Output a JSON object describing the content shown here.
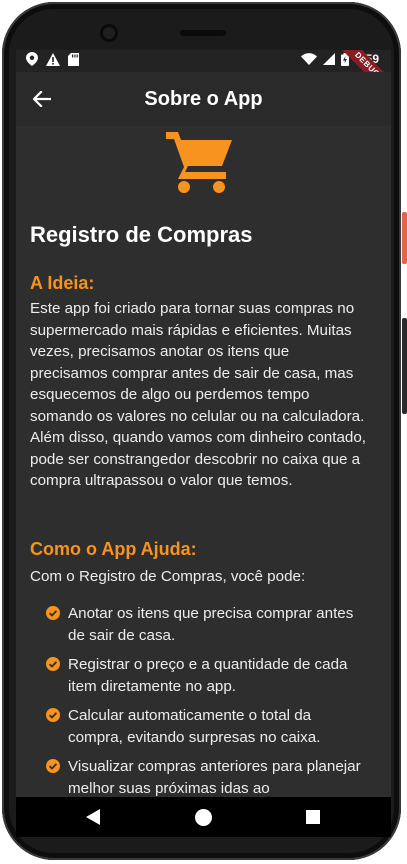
{
  "status_bar": {
    "time": "9:59",
    "debug_label": "DEBUG"
  },
  "app_bar": {
    "title": "Sobre o App"
  },
  "content": {
    "main_title": "Registro de Compras",
    "idea_title": "A Ideia:",
    "idea_text": "Este app foi criado para tornar suas compras no supermercado mais rápidas e eficientes. Muitas vezes, precisamos anotar os itens que precisamos comprar antes de sair de casa, mas esquecemos de algo ou perdemos tempo somando os valores no celular ou na calculadora. Além disso, quando vamos com dinheiro contado, pode ser constrangedor descobrir no caixa que a compra ultrapassou o valor que temos.",
    "help_title": "Como o App Ajuda:",
    "help_intro": "Com o Registro de Compras, você pode:",
    "bullets": [
      "Anotar os itens que precisa comprar antes de sair de casa.",
      "Registrar o preço e a quantidade de cada item diretamente no app.",
      "Calcular automaticamente o total da compra, evitando surpresas no caixa.",
      "Visualizar compras anteriores para planejar melhor suas próximas idas ao"
    ]
  },
  "colors": {
    "accent": "#f7931e",
    "background": "#2e2e2e",
    "app_bar": "#2a2a2a",
    "text": "#ededed"
  },
  "icons": {
    "back": "arrow-back-icon",
    "cart": "shopping-cart-icon",
    "check": "check-circle-icon"
  }
}
